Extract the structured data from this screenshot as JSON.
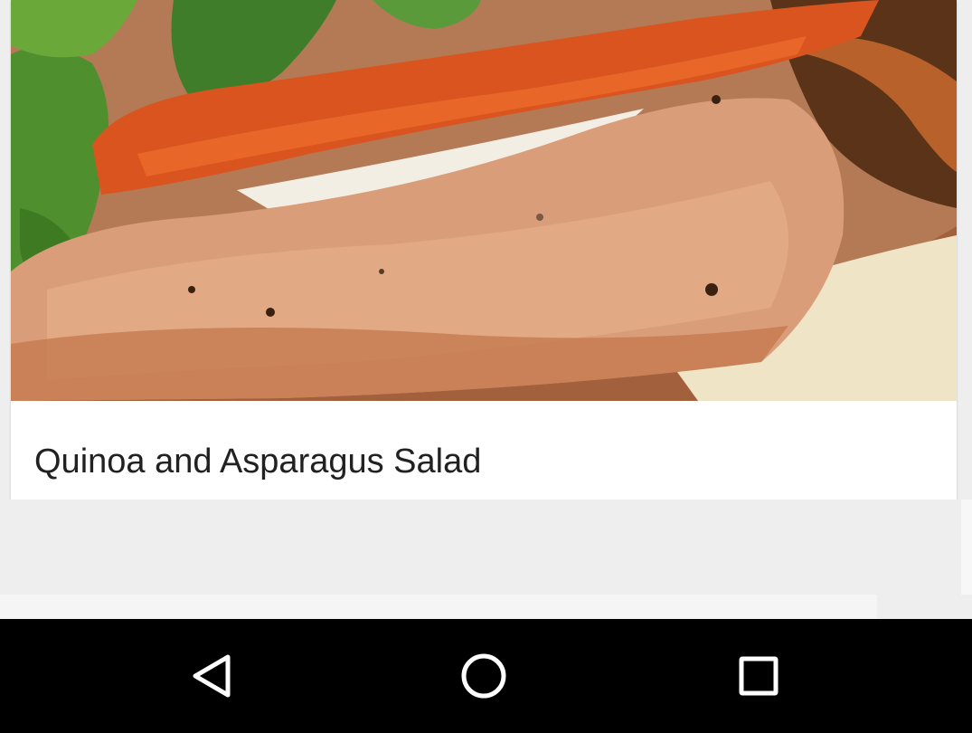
{
  "card": {
    "image_alt": "Grilled chicken sandwich with tomato and lettuce",
    "title": "Quinoa and Asparagus Salad"
  },
  "nav_bar": {
    "back_icon": "back-triangle-icon",
    "home_icon": "home-circle-icon",
    "recents_icon": "recents-square-icon",
    "icon_color": "#ffffff",
    "background": "#000000"
  }
}
